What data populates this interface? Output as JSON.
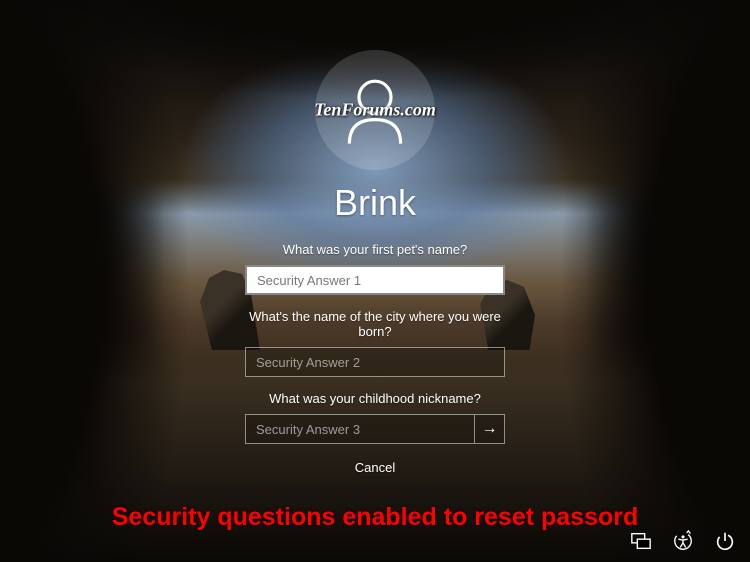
{
  "watermark": "TenForums.com",
  "user": {
    "name": "Brink"
  },
  "questions": {
    "q1": "What was your first pet's name?",
    "q2": "What's the name of the city where you were born?",
    "q3": "What was your childhood nickname?"
  },
  "placeholders": {
    "a1": "Security Answer 1",
    "a2": "Security Answer 2",
    "a3": "Security Answer 3"
  },
  "buttons": {
    "cancel": "Cancel"
  },
  "caption": "Security questions enabled to reset passord",
  "icons": {
    "submit": "→"
  }
}
